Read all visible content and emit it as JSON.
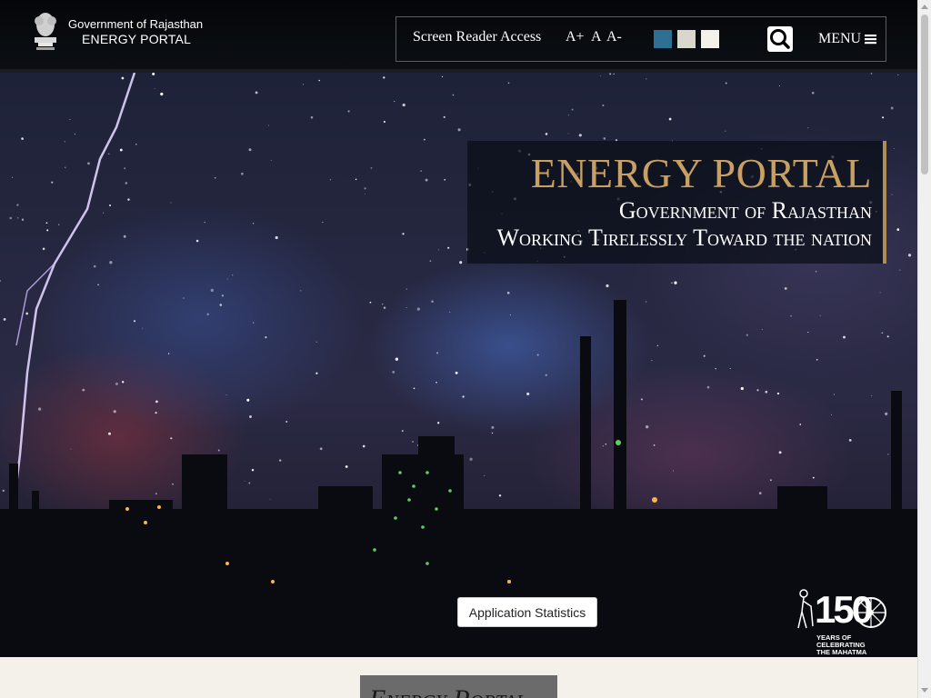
{
  "header": {
    "org": "Government of Rajasthan",
    "portal": "ENERGY PORTAL"
  },
  "accessibility": {
    "screen_reader": "Screen Reader Access",
    "font_increase": "A+",
    "font_normal": "A",
    "font_decrease": "A-",
    "themes": [
      "#2e6f94",
      "#d9d6cc",
      "#f3f1ea"
    ],
    "menu_label": "MENU"
  },
  "hero": {
    "title": "ENERGY PORTAL",
    "subtitle": "Government of Rajasthan",
    "tagline": "Working Tirelessly Toward the nation",
    "stats_button": "Application Statistics"
  },
  "gandhi_logo": {
    "number": "150",
    "caption_line1": "YEARS OF",
    "caption_line2": "CELEBRATING",
    "caption_line3": "THE MAHATMA"
  },
  "section": {
    "heading": "Energy Portal"
  },
  "colors": {
    "gold": "#c9a063",
    "header_bg": "#080a0e"
  }
}
